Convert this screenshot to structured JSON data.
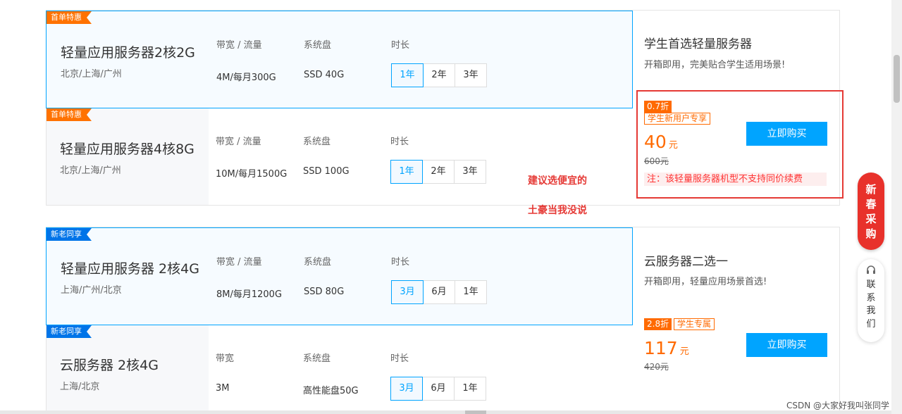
{
  "card1": {
    "rows": [
      {
        "badge": "首单特惠",
        "title": "轻量应用服务器2核2G",
        "region": "北京/上海/广州",
        "headers": [
          "带宽 / 流量",
          "系统盘",
          "时长"
        ],
        "bandwidth": "4M/每月300G",
        "disk": "SSD 40G",
        "durations": [
          "1年",
          "2年",
          "3年"
        ],
        "selected_duration": "1年"
      },
      {
        "badge": "首单特惠",
        "title": "轻量应用服务器4核8G",
        "region": "北京/上海/广州",
        "headers": [
          "带宽 / 流量",
          "系统盘",
          "时长"
        ],
        "bandwidth": "10M/每月1500G",
        "disk": "SSD 100G",
        "durations": [
          "1年",
          "2年",
          "3年"
        ],
        "selected_duration": "1年"
      }
    ],
    "side": {
      "title": "学生首选轻量服务器",
      "subtitle": "开箱即用，完美贴合学生适用场景!",
      "discount": "0.7折",
      "tag": "学生新用户专享",
      "price": "40",
      "price_unit": "元",
      "original_price": "600元",
      "note": "注：该轻量服务器机型不支持同价续费",
      "buy_label": "立即购买"
    }
  },
  "card2": {
    "rows": [
      {
        "badge": "新老同享",
        "title": "轻量应用服务器 2核4G",
        "region": "上海/广州/北京",
        "headers": [
          "带宽 / 流量",
          "系统盘",
          "时长"
        ],
        "bandwidth": "8M/每月1200G",
        "disk": "SSD 80G",
        "durations": [
          "3月",
          "6月",
          "1年"
        ],
        "selected_duration": "3月"
      },
      {
        "badge": "新老同享",
        "title": "云服务器 2核4G",
        "region": "上海/北京",
        "headers": [
          "带宽",
          "系统盘",
          "时长"
        ],
        "bandwidth": "3M",
        "disk": "高性能盘50G",
        "durations": [
          "3月",
          "6月",
          "1年"
        ],
        "selected_duration": "3月"
      }
    ],
    "side": {
      "title": "云服务器二选一",
      "subtitle": "开箱即用，轻量应用场景首选!",
      "discount": "2.8折",
      "tag": "学生专属",
      "price": "117",
      "price_unit": "元",
      "original_price": "420元",
      "buy_label": "立即购买"
    }
  },
  "annotations": [
    "建议选便宜的",
    "土豪当我没说"
  ],
  "float_promo": [
    "新",
    "春",
    "采",
    "购"
  ],
  "float_contact": [
    "联",
    "系",
    "我",
    "们"
  ],
  "watermark": "CSDN @大家好我叫张同学",
  "colors": {
    "accent": "#00a4ff",
    "orange": "#ff6a00",
    "annotation_red": "#e53935",
    "badge_blue": "#0074e8"
  }
}
